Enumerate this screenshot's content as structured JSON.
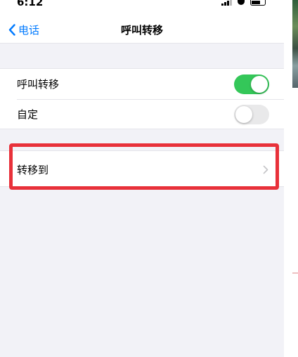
{
  "status_bar": {
    "time": "6:12"
  },
  "nav": {
    "back_label": "电话",
    "title": "呼叫转移"
  },
  "settings": {
    "call_forwarding": {
      "label": "呼叫转移",
      "enabled": true
    },
    "custom": {
      "label": "自定",
      "enabled": false
    },
    "forward_to": {
      "label": "转移到"
    }
  },
  "colors": {
    "accent": "#007aff",
    "switch_on": "#34c759",
    "switch_off": "#e9e9ea",
    "highlight": "#e8313a",
    "background": "#f2f2f7"
  },
  "icons": {
    "back": "chevron-left-icon",
    "disclosure": "chevron-right-icon",
    "signal": "signal-icon",
    "wifi": "wifi-icon",
    "battery": "battery-icon"
  }
}
